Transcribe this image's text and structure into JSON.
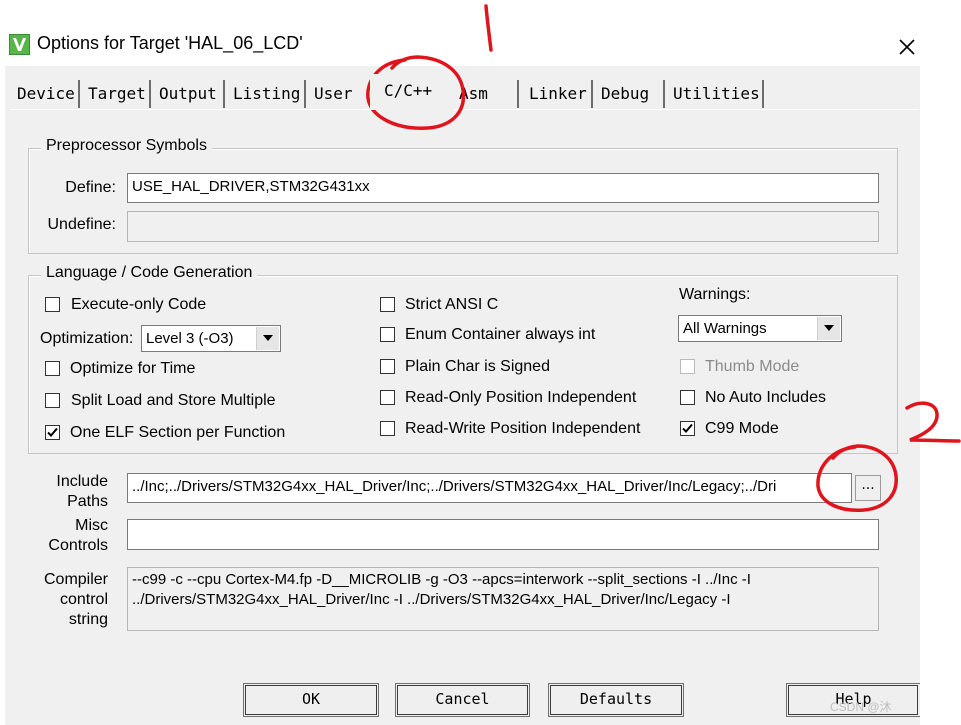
{
  "window": {
    "title": "Options for Target 'HAL_06_LCD'"
  },
  "tabs": [
    "Device",
    "Target",
    "Output",
    "Listing",
    "User",
    "C/C++",
    "Asm",
    "Linker",
    "Debug",
    "Utilities"
  ],
  "active_tab": "C/C++",
  "preprocessor": {
    "title": "Preprocessor Symbols",
    "define_label": "Define:",
    "define_value": "USE_HAL_DRIVER,STM32G431xx",
    "undefine_label": "Undefine:",
    "undefine_value": ""
  },
  "language": {
    "title": "Language / Code Generation",
    "execute_only": {
      "label": "Execute-only Code",
      "checked": false
    },
    "optimization_label": "Optimization:",
    "optimization_value": "Level 3 (-O3)",
    "optimize_time": {
      "label": "Optimize for Time",
      "checked": false
    },
    "split_load": {
      "label": "Split Load and Store Multiple",
      "checked": false
    },
    "one_elf": {
      "label": "One ELF Section per Function",
      "checked": true
    },
    "strict_ansi": {
      "label": "Strict ANSI C",
      "checked": false
    },
    "enum_container": {
      "label": "Enum Container always int",
      "checked": false
    },
    "plain_char": {
      "label": "Plain Char is Signed",
      "checked": false
    },
    "ro_pos_indep": {
      "label": "Read-Only Position Independent",
      "checked": false
    },
    "rw_pos_indep": {
      "label": "Read-Write Position Independent",
      "checked": false
    },
    "warnings_label": "Warnings:",
    "warnings_value": "All Warnings",
    "thumb_mode": {
      "label": "Thumb Mode",
      "checked": false,
      "disabled": true
    },
    "no_auto_includes": {
      "label": "No Auto Includes",
      "checked": false
    },
    "c99_mode": {
      "label": "C99 Mode",
      "checked": true
    }
  },
  "include_paths": {
    "label_1": "Include",
    "label_2": "Paths",
    "value": "../Inc;../Drivers/STM32G4xx_HAL_Driver/Inc;../Drivers/STM32G4xx_HAL_Driver/Inc/Legacy;../Dri",
    "browse_label": "..."
  },
  "misc_controls": {
    "label_1": "Misc",
    "label_2": "Controls",
    "value": ""
  },
  "compiler_string": {
    "label_1": "Compiler",
    "label_2": "control",
    "label_3": "string",
    "value": "--c99 -c --cpu Cortex-M4.fp -D__MICROLIB -g -O3 --apcs=interwork --split_sections -I ../Inc -I ../Drivers/STM32G4xx_HAL_Driver/Inc -I ../Drivers/STM32G4xx_HAL_Driver/Inc/Legacy -I"
  },
  "buttons": {
    "ok": "OK",
    "cancel": "Cancel",
    "defaults": "Defaults",
    "help": "Help"
  },
  "watermark": "CSDN @沐",
  "colors": {
    "annotation": "#e0141c",
    "dialog_bg": "#f0f0f0"
  }
}
